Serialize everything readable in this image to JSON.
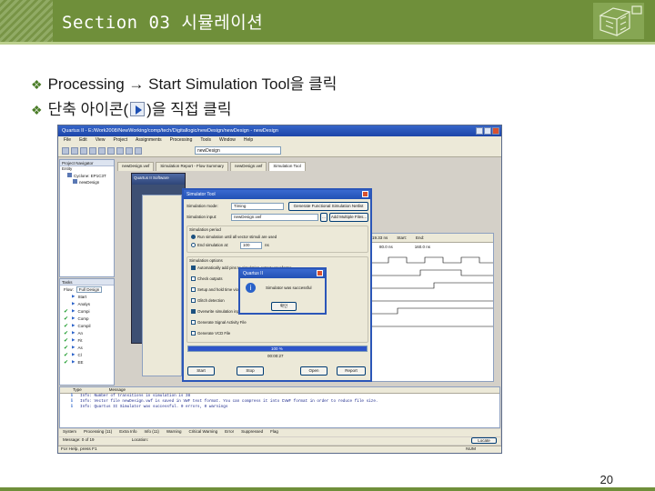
{
  "slide": {
    "title": "Section 03 시뮬레이션",
    "bullet1_text": "Processing → Start Simulation Tool을 클릭",
    "bullet2_before": "단축 아이콘(",
    "bullet2_after": ")을 직접 클릭",
    "page_number": "20",
    "bullet_marker": "❖",
    "accent_color": "#6f8f3a",
    "header_logo_icon": "cube-diagram-icon"
  },
  "app": {
    "title": "Quartus II - E:/Work2008/NewWorking/comp/tech/Digitallogic/newDesign/newDesign - newDesign",
    "menu": [
      "File",
      "Edit",
      "View",
      "Project",
      "Assignments",
      "Processing",
      "Tools",
      "Window",
      "Help"
    ],
    "toolbar_combo": "newDesign",
    "tabs": [
      "newDesign.vwf",
      "Simulation Report - Flow Summary",
      "newDesign.vwf",
      "Simulation Tool"
    ],
    "project_navigator_header": "Project Navigator",
    "entity_header": "Entity",
    "tree": [
      "Cyclone: EP1C3T",
      "newDesign"
    ],
    "tasks_header": "Tasks",
    "flow_label": "Flow:",
    "flow_value": "Full Design",
    "tasks": [
      {
        "label": "Start",
        "done": false
      },
      {
        "label": "Analys",
        "done": false
      },
      {
        "label": "Compi",
        "done": true
      },
      {
        "label": "Comp",
        "done": true
      },
      {
        "label": "Compil",
        "done": true
      },
      {
        "label": "An",
        "done": true
      },
      {
        "label": "Fit",
        "done": true
      },
      {
        "label": "As",
        "done": true
      },
      {
        "label": "Cl",
        "done": true
      },
      {
        "label": "EE",
        "done": true
      }
    ]
  },
  "sim_dialog": {
    "title": "Simulator Tool",
    "mode_label": "Simulation mode:",
    "mode_value": "Timing",
    "generate_btn": "Generate Functional Simulation Netlist",
    "input_label": "Simulation input:",
    "input_value": "newDesign.vwf",
    "browse": "...",
    "add_multiple": "Add Multiple Files...",
    "period_header": "Simulation period",
    "period_opt1": "Run simulation until all vector stimuli are used",
    "period_opt2": "End simulation at:",
    "period_value": "100",
    "period_unit": "ns",
    "options_header": "Simulation options",
    "options": [
      {
        "label": "Automatically add pins to simulation output waveforms",
        "checked": true
      },
      {
        "label": "Check outputs",
        "checked": false
      },
      {
        "label": "Setup and hold time violation detection",
        "checked": false
      },
      {
        "label": "Glitch detection",
        "checked": false
      },
      {
        "label": "Overwrite simulation input file with simulation results",
        "checked": true
      },
      {
        "label": "Generate Signal Activity File",
        "checked": false
      },
      {
        "label": "Generate VCD File",
        "checked": false
      }
    ],
    "progress_percent": 100,
    "progress_text": "100 %",
    "elapsed": "00:00:27",
    "start_btn": "Start",
    "stop_btn": "Stop",
    "open_btn": "Open",
    "report_btn": "Report"
  },
  "msgbox": {
    "title": "Quartus II",
    "text": "Simulator was successful",
    "ok": "확인"
  },
  "waveform": {
    "col_value": "Value at",
    "col_value2": "0 ps",
    "time1": "80.0 ns",
    "time2": "160.0 ns",
    "header_values": [
      "19.33 ns",
      "Start:",
      "End:"
    ]
  },
  "messages": {
    "type_header": "Type",
    "message_header": "Message",
    "rows": [
      "Info: Number of transitions in simulation is 38",
      "Info: Vector file newDesign.vwf is saved in VWF text format. You can compress it into CVWF format in order to reduce file size.",
      "Info: Quartus II Simulator was successful. 0 errors, 0 warnings"
    ],
    "tabs": [
      "System",
      "Processing (11)",
      "Extra Info",
      "Info (11)",
      "Warning",
      "Critical Warning",
      "Error",
      "Suppressed",
      "Flag"
    ],
    "locate_label": "Message: 0 of 19",
    "location_label": "Location:",
    "locate_btn": "Locate"
  },
  "status": {
    "help_text": "For Help, press F1",
    "num": "NUM"
  }
}
